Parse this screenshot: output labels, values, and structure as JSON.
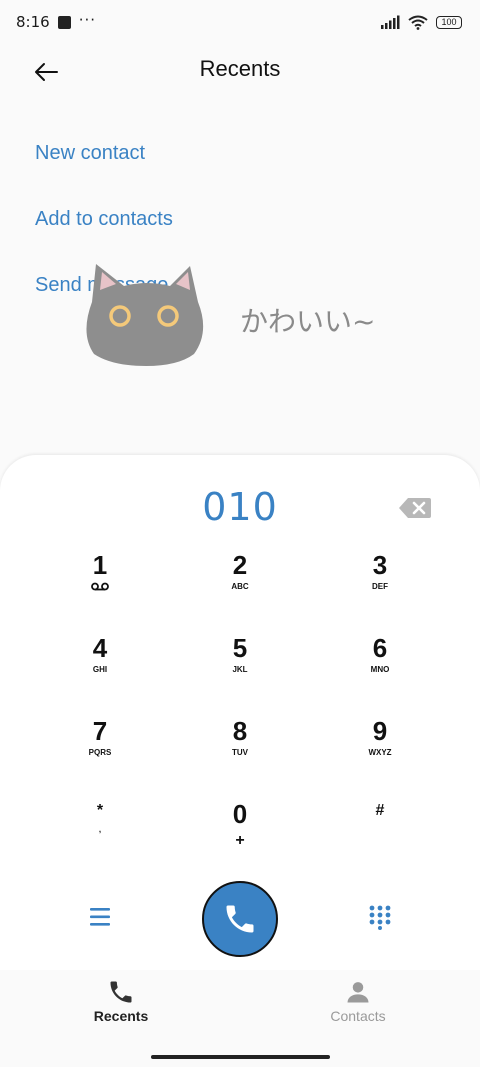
{
  "status_bar": {
    "time": "8:16",
    "dots": "···",
    "battery": "100"
  },
  "header": {
    "title": "Recents"
  },
  "actions": [
    {
      "label": "New contact"
    },
    {
      "label": "Add to contacts"
    },
    {
      "label": "Send message"
    }
  ],
  "sticker": {
    "text": "かわいい~"
  },
  "dialer": {
    "number": "010",
    "keys": [
      {
        "digit": "1",
        "letters": ""
      },
      {
        "digit": "2",
        "letters": "ABC"
      },
      {
        "digit": "3",
        "letters": "DEF"
      },
      {
        "digit": "4",
        "letters": "GHI"
      },
      {
        "digit": "5",
        "letters": "JKL"
      },
      {
        "digit": "6",
        "letters": "MNO"
      },
      {
        "digit": "7",
        "letters": "PQRS"
      },
      {
        "digit": "8",
        "letters": "TUV"
      },
      {
        "digit": "9",
        "letters": "WXYZ"
      },
      {
        "digit": "*",
        "letters": ","
      },
      {
        "digit": "0",
        "letters": "+"
      },
      {
        "digit": "#",
        "letters": ""
      }
    ]
  },
  "nav": {
    "recents": "Recents",
    "contacts": "Contacts"
  },
  "colors": {
    "accent": "#3a82c4",
    "background": "#fafafa"
  }
}
